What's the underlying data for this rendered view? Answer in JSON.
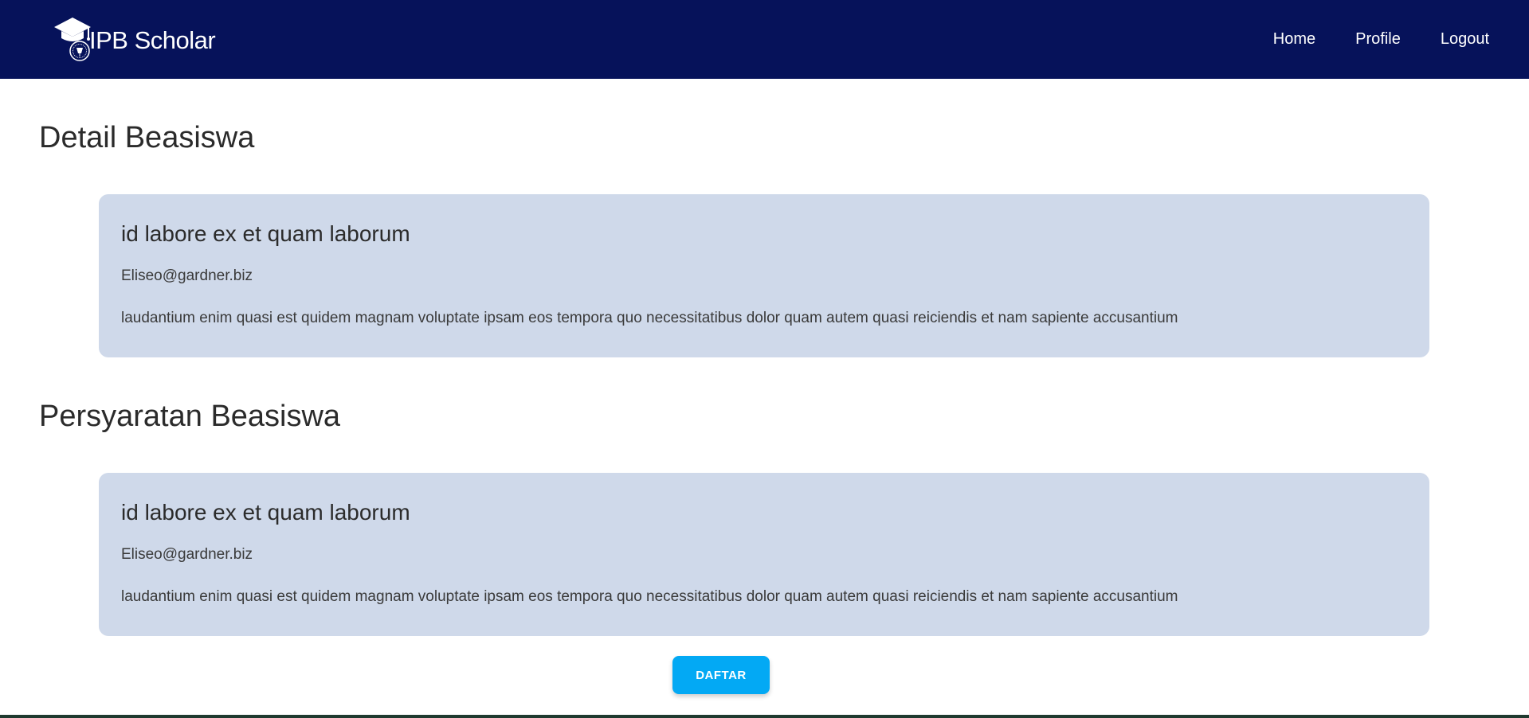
{
  "brand": {
    "name": "IPB Scholar",
    "logo_icon": "graduation-cap-logo-icon"
  },
  "nav": {
    "items": [
      {
        "label": "Home"
      },
      {
        "label": "Profile"
      },
      {
        "label": "Logout"
      }
    ]
  },
  "sections": [
    {
      "title": "Detail Beasiswa",
      "card": {
        "title": "id labore ex et quam laborum",
        "email": "Eliseo@gardner.biz",
        "description": "laudantium enim quasi est quidem magnam voluptate ipsam eos tempora quo necessitatibus dolor quam autem quasi reiciendis et nam sapiente accusantium"
      }
    },
    {
      "title": "Persyaratan Beasiswa",
      "card": {
        "title": "id labore ex et quam laborum",
        "email": "Eliseo@gardner.biz",
        "description": "laudantium enim quasi est quidem magnam voluptate ipsam eos tempora quo necessitatibus dolor quam autem quasi reiciendis et nam sapiente accusantium"
      }
    }
  ],
  "action": {
    "daftar_label": "DAFTAR"
  },
  "colors": {
    "navbar": "#06125a",
    "card": "#cfd9ea",
    "button": "#03a9f4"
  }
}
